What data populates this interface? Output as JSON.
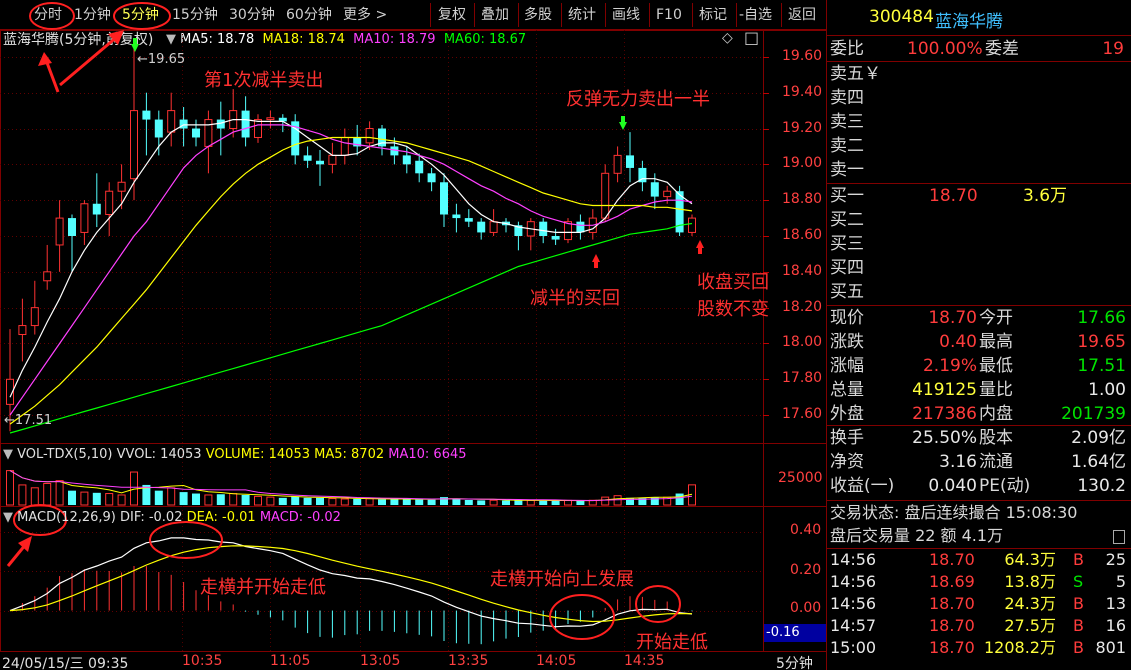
{
  "toolbar": {
    "left_items": [
      "分时",
      "1分钟",
      "5分钟",
      "15分钟",
      "30分钟",
      "60分钟",
      "更多 >"
    ],
    "selected": "5分钟",
    "right_items": [
      "复权",
      "叠加",
      "多股",
      "统计",
      "画线",
      "F10",
      "标记",
      "-自选",
      "返回"
    ]
  },
  "chart_header": {
    "stock_name": "蓝海华腾",
    "period_label": "(5分钟,前复权)",
    "ma_labels": [
      "MA5: 18.78",
      "MA18: 18.74",
      "MA10: 18.79",
      "MA60: 18.67"
    ],
    "ma_colors": [
      "#ffffff",
      "#ffff00",
      "#ff40ff",
      "#00ff00"
    ]
  },
  "price_axis": [
    "19.60",
    "19.40",
    "19.20",
    "19.00",
    "18.80",
    "18.60",
    "18.40",
    "18.20",
    "18.00",
    "17.80",
    "17.60"
  ],
  "high_marker": "19.65",
  "low_marker": "17.51",
  "volume_header": {
    "name": "VOL-TDX(5,10)",
    "vvol": "VVOL: 14053",
    "volume": "VOLUME: 14053",
    "ma5": "MA5: 8702",
    "ma10": "MA10: 6645"
  },
  "volume_axis": "25000",
  "macd_header": {
    "name": "MACD",
    "params": "(12,26,9)",
    "dif": "DIF: -0.02",
    "dea": "DEA: -0.01",
    "macd": "MACD: -0.02"
  },
  "macd_axis": [
    "0.40",
    "0.20",
    "0.00"
  ],
  "macd_value_box": "-0.16",
  "time_axis": [
    "24/05/15/三 09:35",
    "10:35",
    "11:05",
    "13:05",
    "13:35",
    "14:05",
    "14:35"
  ],
  "period_tag": "5分钟",
  "annotations": {
    "first_sell": "第1次减半卖出",
    "rebound_sell": "反弹无力卖出一半",
    "buyback": "减半的买回",
    "close_buy_1": "收盘买回",
    "close_buy_2": "股数不变",
    "macd_flat_down": "走横并开始走低",
    "macd_flat_up": "走横开始向上发展",
    "macd_start_low": "开始走低"
  },
  "quote": {
    "code": "300484",
    "name": "蓝海华腾",
    "weibi_label": "委比",
    "weibi": "100.00%",
    "weicha_label": "委差",
    "weicha": "19",
    "sell_levels": [
      "卖五￥",
      "卖四",
      "卖三",
      "卖二",
      "卖一"
    ],
    "buy_levels": [
      {
        "label": "买一",
        "price": "18.70",
        "vol": "3.6万"
      },
      {
        "label": "买二",
        "price": "",
        "vol": ""
      },
      {
        "label": "买三",
        "price": "",
        "vol": ""
      },
      {
        "label": "买四",
        "price": "",
        "vol": ""
      },
      {
        "label": "买五",
        "price": "",
        "vol": ""
      }
    ],
    "stats": [
      {
        "l1": "现价",
        "v1": "18.70",
        "c1": "red",
        "l2": "今开",
        "v2": "17.66",
        "c2": "grn"
      },
      {
        "l1": "涨跌",
        "v1": "0.40",
        "c1": "red",
        "l2": "最高",
        "v2": "19.65",
        "c2": "red"
      },
      {
        "l1": "涨幅",
        "v1": "2.19%",
        "c1": "red",
        "l2": "最低",
        "v2": "17.51",
        "c2": "grn"
      },
      {
        "l1": "总量",
        "v1": "419125",
        "c1": "yel",
        "l2": "量比",
        "v2": "1.00",
        "c2": "wht"
      },
      {
        "l1": "外盘",
        "v1": "217386",
        "c1": "red",
        "l2": "内盘",
        "v2": "201739",
        "c2": "grn"
      }
    ],
    "stats2": [
      {
        "l1": "换手",
        "v1": "25.50%",
        "l2": "股本",
        "v2": "2.09亿"
      },
      {
        "l1": "净资",
        "v1": "3.16",
        "l2": "流通",
        "v2": "1.64亿"
      },
      {
        "l1": "收益(一)",
        "v1": "0.040",
        "l2": "PE(动)",
        "v2": "130.2"
      }
    ],
    "trade_status": "交易状态: 盘后连续撮合 15:08:30",
    "after_hours": "盘后交易量 22 额 4.1万",
    "ticks": [
      {
        "t": "14:56",
        "p": "18.70",
        "v": "64.3万",
        "s": "B",
        "n": "25"
      },
      {
        "t": "14:56",
        "p": "18.69",
        "v": "13.8万",
        "s": "S",
        "n": "5"
      },
      {
        "t": "14:56",
        "p": "18.70",
        "v": "24.3万",
        "s": "B",
        "n": "13"
      },
      {
        "t": "14:57",
        "p": "18.70",
        "v": "27.5万",
        "s": "B",
        "n": "16"
      },
      {
        "t": "15:00",
        "p": "18.70",
        "v": "1208.2万",
        "s": "B",
        "n": "801"
      }
    ]
  },
  "chart_data": {
    "type": "candlestick",
    "ohlc": [
      [
        17.66,
        17.8,
        17.51,
        18.08
      ],
      [
        18.05,
        18.1,
        17.9,
        18.25
      ],
      [
        18.1,
        18.2,
        18.05,
        18.35
      ],
      [
        18.35,
        18.4,
        18.3,
        18.55
      ],
      [
        18.55,
        18.7,
        18.4,
        18.8
      ],
      [
        18.7,
        18.6,
        18.4,
        18.72
      ],
      [
        18.62,
        18.78,
        18.55,
        18.8
      ],
      [
        18.78,
        18.72,
        18.65,
        18.95
      ],
      [
        18.72,
        18.85,
        18.6,
        18.9
      ],
      [
        18.85,
        18.9,
        18.75,
        19.0
      ],
      [
        18.92,
        19.3,
        18.8,
        19.65
      ],
      [
        19.3,
        19.25,
        19.05,
        19.4
      ],
      [
        19.25,
        19.15,
        19.05,
        19.3
      ],
      [
        19.18,
        19.3,
        19.1,
        19.4
      ],
      [
        19.25,
        19.2,
        19.1,
        19.32
      ],
      [
        19.2,
        19.15,
        19.1,
        19.25
      ],
      [
        19.1,
        19.25,
        18.95,
        19.3
      ],
      [
        19.25,
        19.2,
        19.05,
        19.35
      ],
      [
        19.2,
        19.3,
        19.15,
        19.42
      ],
      [
        19.3,
        19.15,
        19.1,
        19.38
      ],
      [
        19.15,
        19.25,
        19.12,
        19.28
      ],
      [
        19.25,
        19.26,
        19.2,
        19.3
      ],
      [
        19.26,
        19.24,
        19.18,
        19.28
      ],
      [
        19.24,
        19.05,
        19.0,
        19.28
      ],
      [
        19.05,
        19.02,
        18.98,
        19.1
      ],
      [
        19.02,
        19.0,
        18.88,
        19.08
      ],
      [
        19.0,
        19.05,
        18.95,
        19.12
      ],
      [
        19.05,
        19.15,
        19.0,
        19.2
      ],
      [
        19.15,
        19.1,
        19.05,
        19.22
      ],
      [
        19.12,
        19.2,
        19.08,
        19.24
      ],
      [
        19.2,
        19.1,
        19.05,
        19.22
      ],
      [
        19.1,
        19.05,
        19.0,
        19.15
      ],
      [
        19.05,
        19.0,
        18.95,
        19.1
      ],
      [
        19.02,
        18.95,
        18.9,
        19.06
      ],
      [
        18.95,
        18.9,
        18.85,
        18.98
      ],
      [
        18.9,
        18.72,
        18.65,
        18.95
      ],
      [
        18.72,
        18.7,
        18.62,
        18.78
      ],
      [
        18.7,
        18.68,
        18.65,
        18.75
      ],
      [
        18.68,
        18.62,
        18.58,
        18.7
      ],
      [
        18.62,
        18.68,
        18.6,
        18.75
      ],
      [
        18.68,
        18.66,
        18.62,
        18.7
      ],
      [
        18.66,
        18.6,
        18.52,
        18.68
      ],
      [
        18.6,
        18.68,
        18.52,
        18.7
      ],
      [
        18.68,
        18.6,
        18.56,
        18.7
      ],
      [
        18.6,
        18.58,
        18.55,
        18.64
      ],
      [
        18.58,
        18.68,
        18.56,
        18.7
      ],
      [
        18.68,
        18.62,
        18.58,
        18.72
      ],
      [
        18.62,
        18.7,
        18.58,
        18.75
      ],
      [
        18.7,
        18.95,
        18.68,
        19.0
      ],
      [
        18.95,
        19.05,
        18.9,
        19.1
      ],
      [
        19.05,
        18.98,
        18.9,
        19.18
      ],
      [
        18.98,
        18.9,
        18.85,
        19.02
      ],
      [
        18.9,
        18.82,
        18.75,
        18.95
      ],
      [
        18.82,
        18.85,
        18.78,
        18.88
      ],
      [
        18.85,
        18.62,
        18.6,
        18.88
      ],
      [
        18.62,
        18.7,
        18.6,
        18.72
      ]
    ],
    "ma_series": [
      {
        "name": "MA5",
        "color": "#ffffff",
        "values": [
          17.7,
          17.85,
          17.98,
          18.12,
          18.25,
          18.4,
          18.52,
          18.62,
          18.7,
          18.78,
          18.9,
          19.0,
          19.1,
          19.18,
          19.22,
          19.22,
          19.22,
          19.23,
          19.25,
          19.25,
          19.24,
          19.24,
          19.24,
          19.2,
          19.15,
          19.1,
          19.05,
          19.05,
          19.06,
          19.1,
          19.12,
          19.12,
          19.1,
          19.05,
          19.0,
          18.94,
          18.86,
          18.78,
          18.72,
          18.68,
          18.67,
          18.65,
          18.64,
          18.63,
          18.62,
          18.62,
          18.62,
          18.64,
          18.7,
          18.8,
          18.88,
          18.92,
          18.92,
          18.9,
          18.83,
          18.78
        ]
      },
      {
        "name": "MA10",
        "color": "#ff40ff",
        "values": [
          17.6,
          17.7,
          17.8,
          17.9,
          18.0,
          18.1,
          18.2,
          18.3,
          18.4,
          18.5,
          18.6,
          18.68,
          18.78,
          18.88,
          18.98,
          19.05,
          19.1,
          19.14,
          19.18,
          19.2,
          19.22,
          19.22,
          19.22,
          19.21,
          19.19,
          19.17,
          19.14,
          19.12,
          19.11,
          19.1,
          19.09,
          19.08,
          19.07,
          19.05,
          19.03,
          19.0,
          18.96,
          18.92,
          18.88,
          18.85,
          18.81,
          18.78,
          18.74,
          18.71,
          18.69,
          18.67,
          18.66,
          18.66,
          18.68,
          18.71,
          18.75,
          18.77,
          18.79,
          18.8,
          18.8,
          18.79
        ]
      },
      {
        "name": "MA18",
        "color": "#ffff00",
        "values": [
          17.55,
          17.6,
          17.65,
          17.71,
          17.77,
          17.84,
          17.91,
          17.98,
          18.06,
          18.14,
          18.22,
          18.3,
          18.39,
          18.48,
          18.57,
          18.66,
          18.74,
          18.82,
          18.89,
          18.95,
          19.0,
          19.04,
          19.08,
          19.11,
          19.13,
          19.14,
          19.15,
          19.15,
          19.15,
          19.15,
          19.14,
          19.13,
          19.12,
          19.1,
          19.08,
          19.06,
          19.04,
          19.02,
          18.99,
          18.96,
          18.93,
          18.9,
          18.87,
          18.84,
          18.82,
          18.8,
          18.78,
          18.77,
          18.77,
          18.77,
          18.77,
          18.77,
          18.76,
          18.76,
          18.75,
          18.74
        ]
      },
      {
        "name": "MA60",
        "color": "#00ff00",
        "values": [
          17.5,
          17.52,
          17.54,
          17.56,
          17.58,
          17.6,
          17.62,
          17.64,
          17.66,
          17.68,
          17.7,
          17.72,
          17.74,
          17.76,
          17.78,
          17.8,
          17.82,
          17.84,
          17.86,
          17.88,
          17.9,
          17.92,
          17.94,
          17.96,
          17.98,
          18.0,
          18.02,
          18.04,
          18.06,
          18.08,
          18.1,
          18.13,
          18.16,
          18.19,
          18.22,
          18.25,
          18.28,
          18.31,
          18.34,
          18.37,
          18.4,
          18.43,
          18.45,
          18.47,
          18.49,
          18.51,
          18.53,
          18.55,
          18.57,
          18.59,
          18.61,
          18.62,
          18.63,
          18.64,
          18.66,
          18.67
        ]
      }
    ],
    "volume": [
      24000,
      14000,
      12000,
      15000,
      17000,
      10000,
      9000,
      8500,
      8000,
      7000,
      23000,
      14000,
      10000,
      12000,
      9000,
      8000,
      7000,
      7500,
      8000,
      7000,
      6000,
      5500,
      5000,
      6000,
      5000,
      5000,
      4500,
      4200,
      4300,
      4400,
      4000,
      4200,
      4100,
      3800,
      3700,
      5500,
      4500,
      3500,
      3200,
      3300,
      3100,
      3400,
      3200,
      3000,
      2900,
      3200,
      3000,
      3300,
      5500,
      6500,
      5000,
      4800,
      5200,
      5400,
      8000,
      14053
    ],
    "volume_ylim": [
      0,
      30000
    ],
    "ylim": [
      17.45,
      19.75
    ],
    "macd_ylim": [
      -0.2,
      0.52
    ]
  }
}
